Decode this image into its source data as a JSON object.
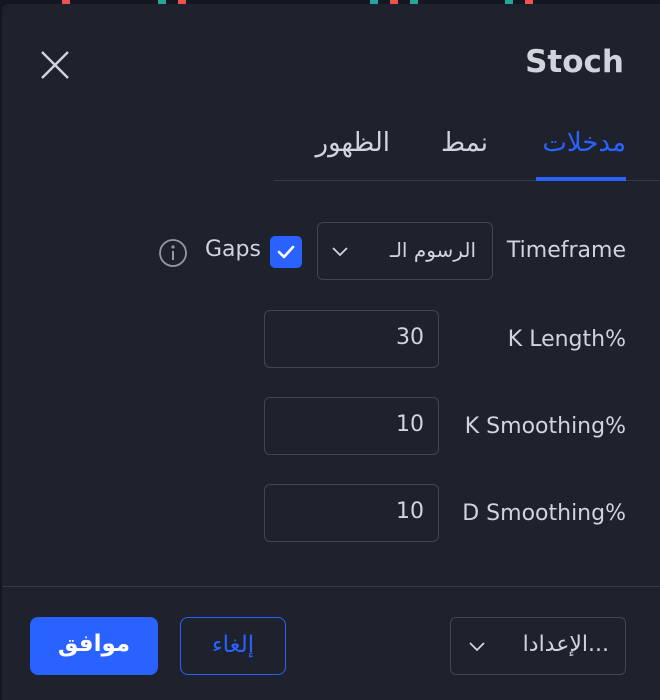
{
  "dialog": {
    "title": "Stoch",
    "tabs": [
      {
        "label": "مدخلات",
        "active": true
      },
      {
        "label": "نمط",
        "active": false
      },
      {
        "label": "الظهور",
        "active": false
      }
    ]
  },
  "inputs": {
    "timeframe": {
      "label": "Timeframe",
      "value": "الرسوم الـ",
      "gaps_label": "Gaps",
      "gaps_checked": true
    },
    "k_length": {
      "label": "K Length%",
      "value": "30"
    },
    "k_smoothing": {
      "label": "K Smoothing%",
      "value": "10"
    },
    "d_smoothing": {
      "label": "D Smoothing%",
      "value": "10"
    }
  },
  "footer": {
    "ok_label": "موافق",
    "cancel_label": "إلغاء",
    "defaults_label": "الإعدادا..."
  },
  "colors": {
    "accent": "#2962ff",
    "background": "#1e222d",
    "text": "#d1d4dc"
  },
  "icons": [
    "close-icon",
    "chevron-down-icon",
    "check-icon",
    "info-icon"
  ]
}
